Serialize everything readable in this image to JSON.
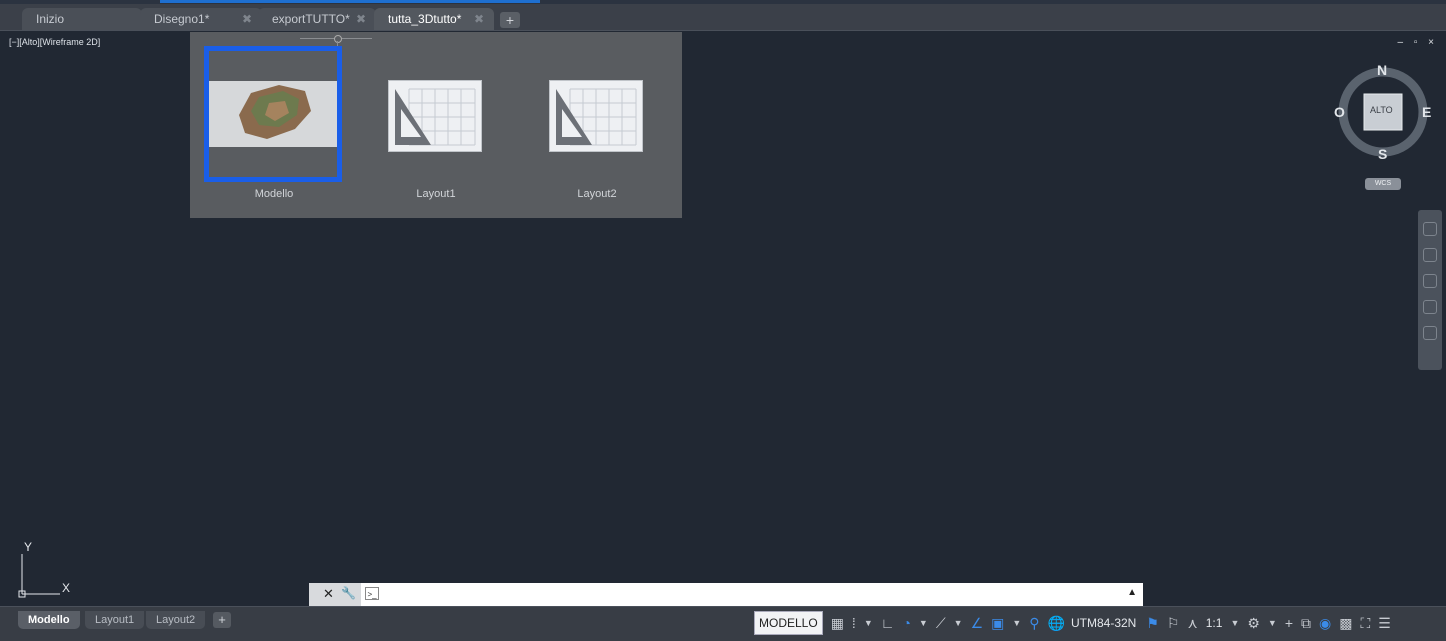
{
  "tabs": [
    {
      "label": "Inizio"
    },
    {
      "label": "Disegno1*"
    },
    {
      "label": "exportTUTTO*"
    },
    {
      "label": "tutta_3Dtutto*"
    }
  ],
  "tab_add_label": "+",
  "tab_close_glyph": "✖",
  "viewport": {
    "label": "[−][Alto][Wireframe 2D]",
    "window_controls": "– ▫ ×"
  },
  "layout_popup": {
    "items": [
      {
        "label": "Modello",
        "selected": true
      },
      {
        "label": "Layout1",
        "selected": false
      },
      {
        "label": "Layout2",
        "selected": false
      }
    ]
  },
  "viewcube": {
    "face": "ALTO",
    "north": "N",
    "south": "S",
    "east": "E",
    "west": "O",
    "wcs": "WCS"
  },
  "ucs": {
    "x": "X",
    "y": "Y"
  },
  "command_line": {
    "close_glyph": "✕",
    "settings_glyph": "🔧",
    "prompt_glyph": ">_",
    "value": "",
    "placeholder": ""
  },
  "layout_tabs": [
    {
      "label": "Modello"
    },
    {
      "label": "Layout1"
    },
    {
      "label": "Layout2"
    }
  ],
  "layout_tab_add": "+",
  "status": {
    "model": "MODELLO",
    "coordinate_system": "UTM84-32N",
    "scale": "1:1"
  },
  "colors": {
    "background": "#212833",
    "selection": "#1a5ee8",
    "accent": "#3b8be8"
  }
}
